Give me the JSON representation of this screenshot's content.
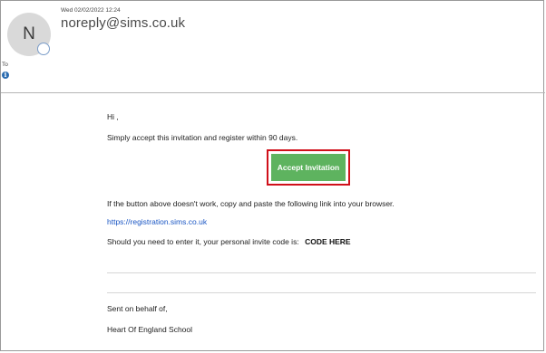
{
  "email": {
    "avatar_initial": "N",
    "timestamp": "Wed 02/02/2022 12:24",
    "sender": "noreply@sims.co.uk",
    "to_label": "To",
    "info_icon": "i"
  },
  "message": {
    "greeting": "Hi ,",
    "intro": "Simply accept this invitation and register within 90 days.",
    "button_label": "Accept Invitation",
    "fallback_text": "If the button above doesn't work, copy and paste the following link into your browser.",
    "link": "https://registration.sims.co.uk",
    "code_prefix": "Should you need to enter it, your personal invite code is:",
    "code": "CODE HERE",
    "signoff": "Sent on behalf of,",
    "school": "Heart Of England School"
  },
  "colors": {
    "button_bg": "#5eb35f",
    "highlight_border": "#d0101a",
    "link": "#1a56c4"
  }
}
